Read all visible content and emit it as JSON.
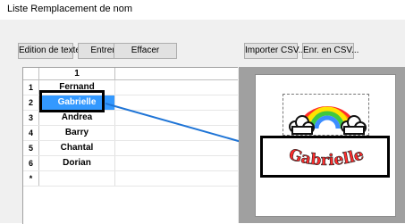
{
  "window": {
    "title": "Liste Remplacement de nom"
  },
  "toolbar": {
    "edition_label": "Edition de texte",
    "entrer_label": "Entrer",
    "effacer_label": "Effacer",
    "import_label": "Importer CSV...",
    "export_label": "Enr. en CSV..."
  },
  "grid": {
    "column_header": "1",
    "rows": [
      {
        "num": "1",
        "name": "Fernand"
      },
      {
        "num": "2",
        "name": "Gabrielle"
      },
      {
        "num": "3",
        "name": "Andrea"
      },
      {
        "num": "4",
        "name": "Barry"
      },
      {
        "num": "5",
        "name": "Chantal"
      },
      {
        "num": "6",
        "name": "Dorian"
      },
      {
        "num": "*",
        "name": ""
      }
    ],
    "selected_row_index": 1
  },
  "preview": {
    "embroidery_text": "Gabrielle",
    "rainbow_colors": [
      "#ff2a2a",
      "#ff9b00",
      "#ffe400",
      "#3fc93f",
      "#3c8dff"
    ],
    "text_color": "#ff2b2b"
  },
  "colors": {
    "selection_blue": "#3399ff",
    "arrow_blue": "#1e74d6"
  }
}
